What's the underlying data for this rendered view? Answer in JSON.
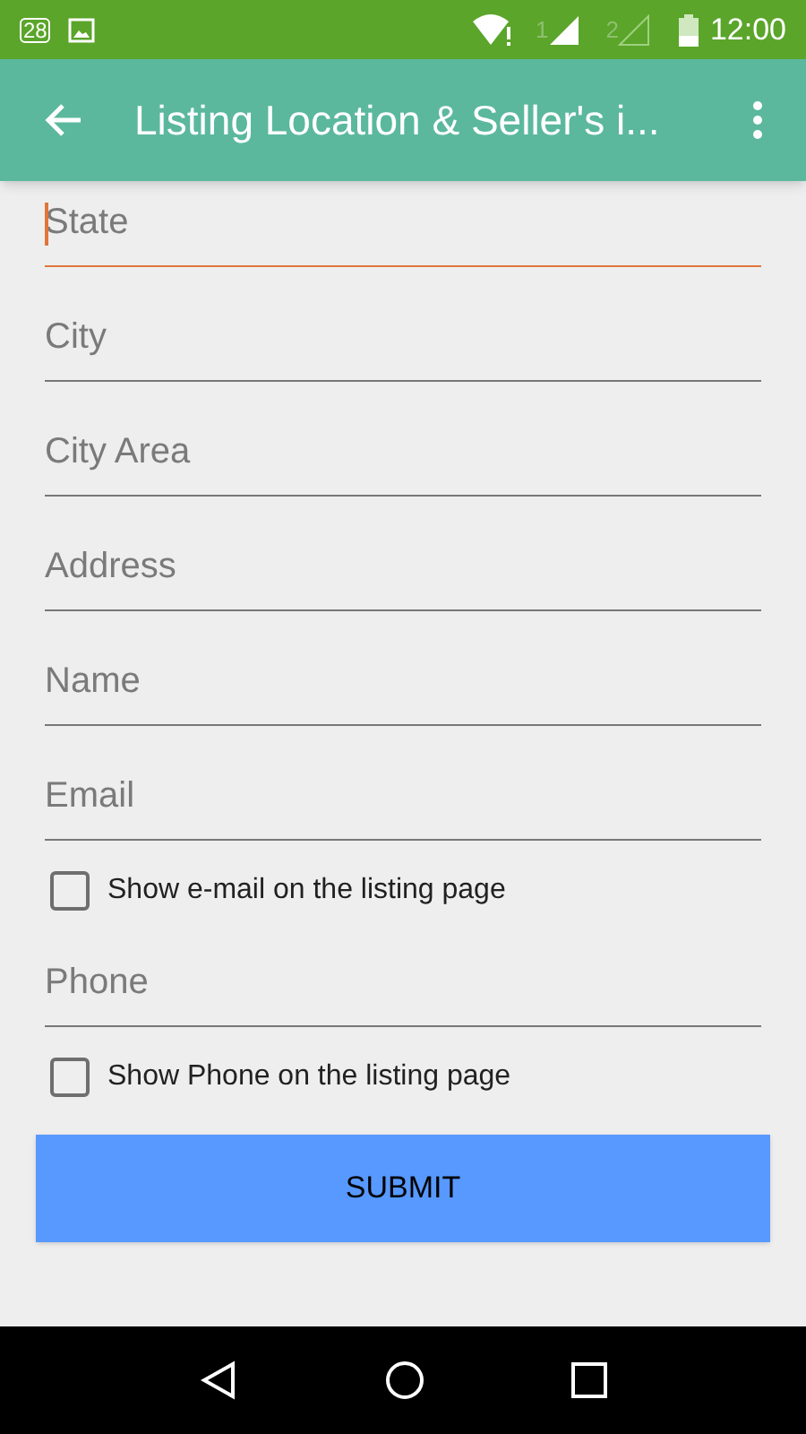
{
  "status_bar": {
    "notification_badge": "28",
    "sim_1": "1",
    "sim_2": "2",
    "time": "12:00"
  },
  "app_bar": {
    "title": "Listing Location & Seller's i..."
  },
  "form": [
    {
      "kind": "field",
      "placeholder": "State",
      "focused": true
    },
    {
      "kind": "field",
      "placeholder": "City",
      "focused": false
    },
    {
      "kind": "field",
      "placeholder": "City Area",
      "focused": false
    },
    {
      "kind": "field",
      "placeholder": "Address",
      "focused": false
    },
    {
      "kind": "field",
      "placeholder": "Name",
      "focused": false
    },
    {
      "kind": "field",
      "placeholder": "Email",
      "focused": false
    },
    {
      "kind": "checkbox",
      "label": "Show e-mail on the listing page",
      "checked": false
    },
    {
      "kind": "field",
      "placeholder": "Phone",
      "focused": false
    },
    {
      "kind": "checkbox",
      "label": "Show Phone on the listing page",
      "checked": false
    }
  ],
  "submit_button": "SUBMIT"
}
